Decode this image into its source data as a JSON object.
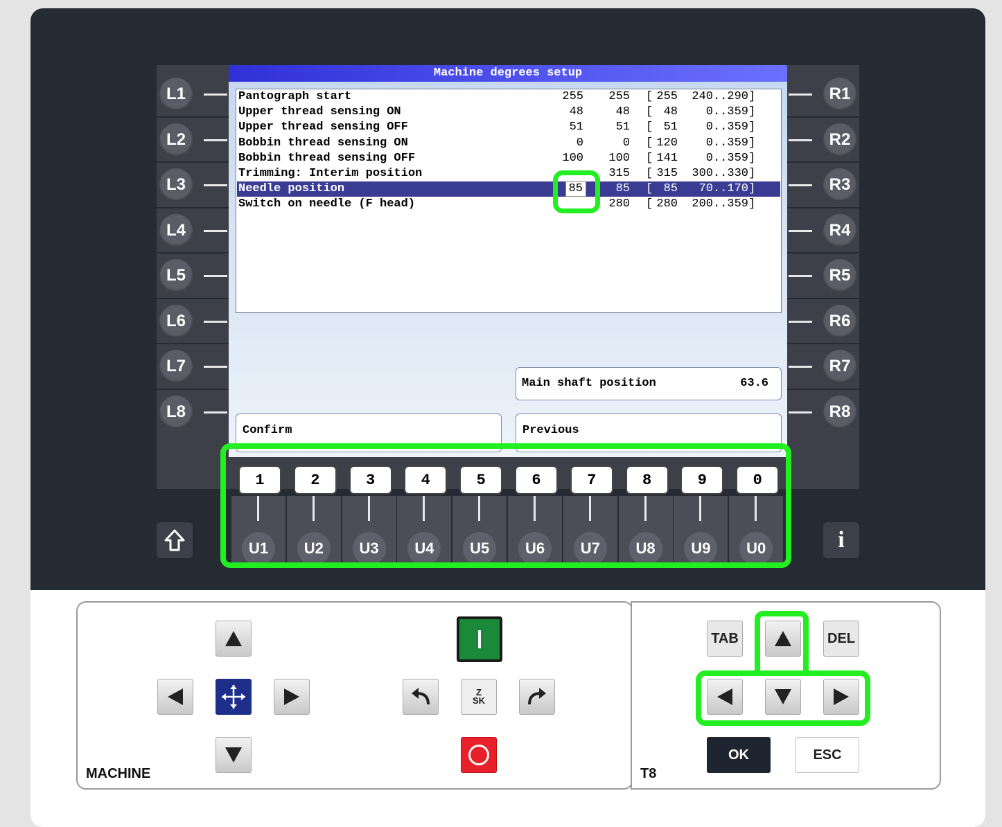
{
  "screen": {
    "title": "Machine degrees setup",
    "rows": [
      {
        "name": "Pantograph start",
        "v1": "255",
        "v2": "255",
        "def": "255",
        "range": "240..290",
        "selected": false
      },
      {
        "name": "Upper thread sensing ON",
        "v1": "48",
        "v2": "48",
        "def": " 48",
        "range": "0..359",
        "selected": false
      },
      {
        "name": "Upper thread sensing OFF",
        "v1": "51",
        "v2": "51",
        "def": " 51",
        "range": "0..359",
        "selected": false
      },
      {
        "name": "Bobbin thread sensing ON",
        "v1": "0",
        "v2": "0",
        "def": "120",
        "range": "0..359",
        "selected": false
      },
      {
        "name": "Bobbin thread sensing OFF",
        "v1": "100",
        "v2": "100",
        "def": "141",
        "range": "0..359",
        "selected": false
      },
      {
        "name": "Trimming: Interim position",
        "v1": "",
        "v2": "315",
        "def": "315",
        "range": "300..330",
        "selected": false
      },
      {
        "name": "Needle position",
        "v1": "85",
        "v2": "85",
        "def": " 85",
        "range": "70..170",
        "selected": true
      },
      {
        "name": "Switch on needle (F head)",
        "v1": "",
        "v2": "280",
        "def": "280",
        "range": "200..359",
        "selected": false
      }
    ],
    "main_shaft": {
      "label": "Main shaft position",
      "value": "63.6"
    },
    "confirm_label": "Confirm",
    "previous_label": "Previous"
  },
  "left_keys": [
    "L1",
    "L2",
    "L3",
    "L4",
    "L5",
    "L6",
    "L7",
    "L8"
  ],
  "right_keys": [
    "R1",
    "R2",
    "R3",
    "R4",
    "R5",
    "R6",
    "R7",
    "R8"
  ],
  "number_keys": [
    "1",
    "2",
    "3",
    "4",
    "5",
    "6",
    "7",
    "8",
    "9",
    "0"
  ],
  "u_keys": [
    "U1",
    "U2",
    "U3",
    "U4",
    "U5",
    "U6",
    "U7",
    "U8",
    "U9",
    "U0"
  ],
  "shift_icon": "shift-arrow-icon",
  "info_label": "i",
  "machine_panel": {
    "label": "MACHINE",
    "zsk_logo": "Z\nSK",
    "icons": [
      "arrow-up-icon",
      "arrow-left-icon",
      "move-cross-icon",
      "arrow-right-icon",
      "arrow-down-icon",
      "start-icon",
      "undo-icon",
      "zsk-logo-icon",
      "redo-icon",
      "stop-icon"
    ]
  },
  "t8_panel": {
    "label": "T8",
    "tab_label": "TAB",
    "del_label": "DEL",
    "ok_label": "OK",
    "esc_label": "ESC"
  },
  "colors": {
    "highlight": "#22ee22",
    "title_bar": "#3030d8",
    "selected_row": "#3a3c93",
    "start_button": "#1a8a3a",
    "stop_button": "#e8202a",
    "ok_button": "#1f2530"
  }
}
